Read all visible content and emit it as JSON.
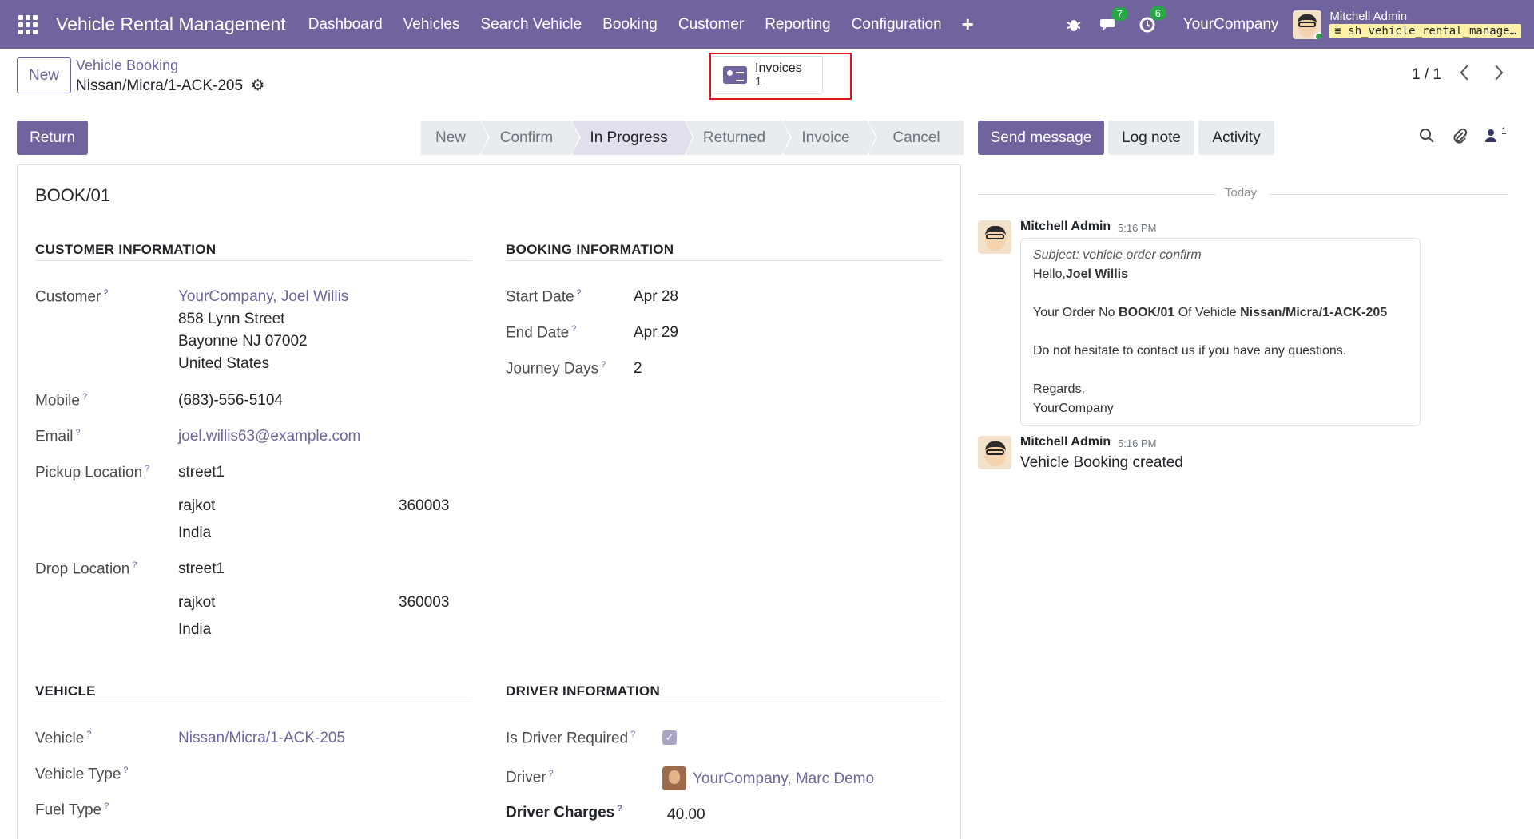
{
  "navbar": {
    "app_title": "Vehicle Rental Management",
    "menu": [
      "Dashboard",
      "Vehicles",
      "Search Vehicle",
      "Booking",
      "Customer",
      "Reporting",
      "Configuration"
    ],
    "plus": "+",
    "messages_count": "7",
    "activities_count": "6",
    "company": "YourCompany",
    "user_name": "Mitchell Admin",
    "database": "sh_vehicle_rental_manage…"
  },
  "control": {
    "new_label": "New",
    "breadcrumb_parent": "Vehicle Booking",
    "breadcrumb_current": "Nissan/Micra/1-ACK-205",
    "smart_button_label": "Invoices",
    "smart_button_count": "1",
    "pager": "1 / 1"
  },
  "statusbar": {
    "return_label": "Return",
    "stages": [
      "New",
      "Confirm",
      "In Progress",
      "Returned",
      "Invoice",
      "Cancel"
    ],
    "active_stage": "In Progress"
  },
  "form": {
    "reference": "BOOK/01",
    "customer_section": {
      "title": "CUSTOMER INFORMATION",
      "customer_label": "Customer",
      "customer_name": "YourCompany, Joel Willis",
      "address_line1": "858 Lynn Street",
      "address_line2": "Bayonne NJ 07002",
      "address_line3": "United States",
      "mobile_label": "Mobile",
      "mobile": "(683)-556-5104",
      "email_label": "Email",
      "email": "joel.willis63@example.com",
      "pickup_label": "Pickup Location",
      "pickup_street": "street1",
      "pickup_city": "rajkot",
      "pickup_zip": "360003",
      "pickup_country": "India",
      "drop_label": "Drop Location",
      "drop_street": "street1",
      "drop_city": "rajkot",
      "drop_zip": "360003",
      "drop_country": "India"
    },
    "booking_section": {
      "title": "BOOKING INFORMATION",
      "start_label": "Start Date",
      "start": "Apr 28",
      "end_label": "End Date",
      "end": "Apr 29",
      "days_label": "Journey Days",
      "days": "2"
    },
    "vehicle_section": {
      "title": "VEHICLE",
      "vehicle_label": "Vehicle",
      "vehicle": "Nissan/Micra/1-ACK-205",
      "type_label": "Vehicle Type",
      "fuel_label": "Fuel Type"
    },
    "driver_section": {
      "title": "DRIVER INFORMATION",
      "required_label": "Is Driver Required",
      "driver_required": true,
      "driver_label": "Driver",
      "driver": "YourCompany, Marc Demo",
      "charges_label": "Driver Charges",
      "charges": "40.00"
    }
  },
  "chatter": {
    "send_message": "Send message",
    "log_note": "Log note",
    "activity": "Activity",
    "followers_count": "1",
    "date_separator": "Today",
    "messages": [
      {
        "author": "Mitchell Admin",
        "time": "5:16 PM",
        "subject": "Subject: vehicle order confirm",
        "greeting": "Hello,",
        "greeting_name": "Joel Willis",
        "order_prefix": "Your Order No ",
        "order_no": "BOOK/01",
        "order_mid": " Of Vehicle ",
        "order_vehicle": "Nissan/Micra/1-ACK-205",
        "line_help": "Do not hesitate to contact us if you have any questions.",
        "regards": "Regards,",
        "signature": "YourCompany"
      },
      {
        "author": "Mitchell Admin",
        "time": "5:16 PM",
        "body": "Vehicle Booking created"
      }
    ]
  }
}
